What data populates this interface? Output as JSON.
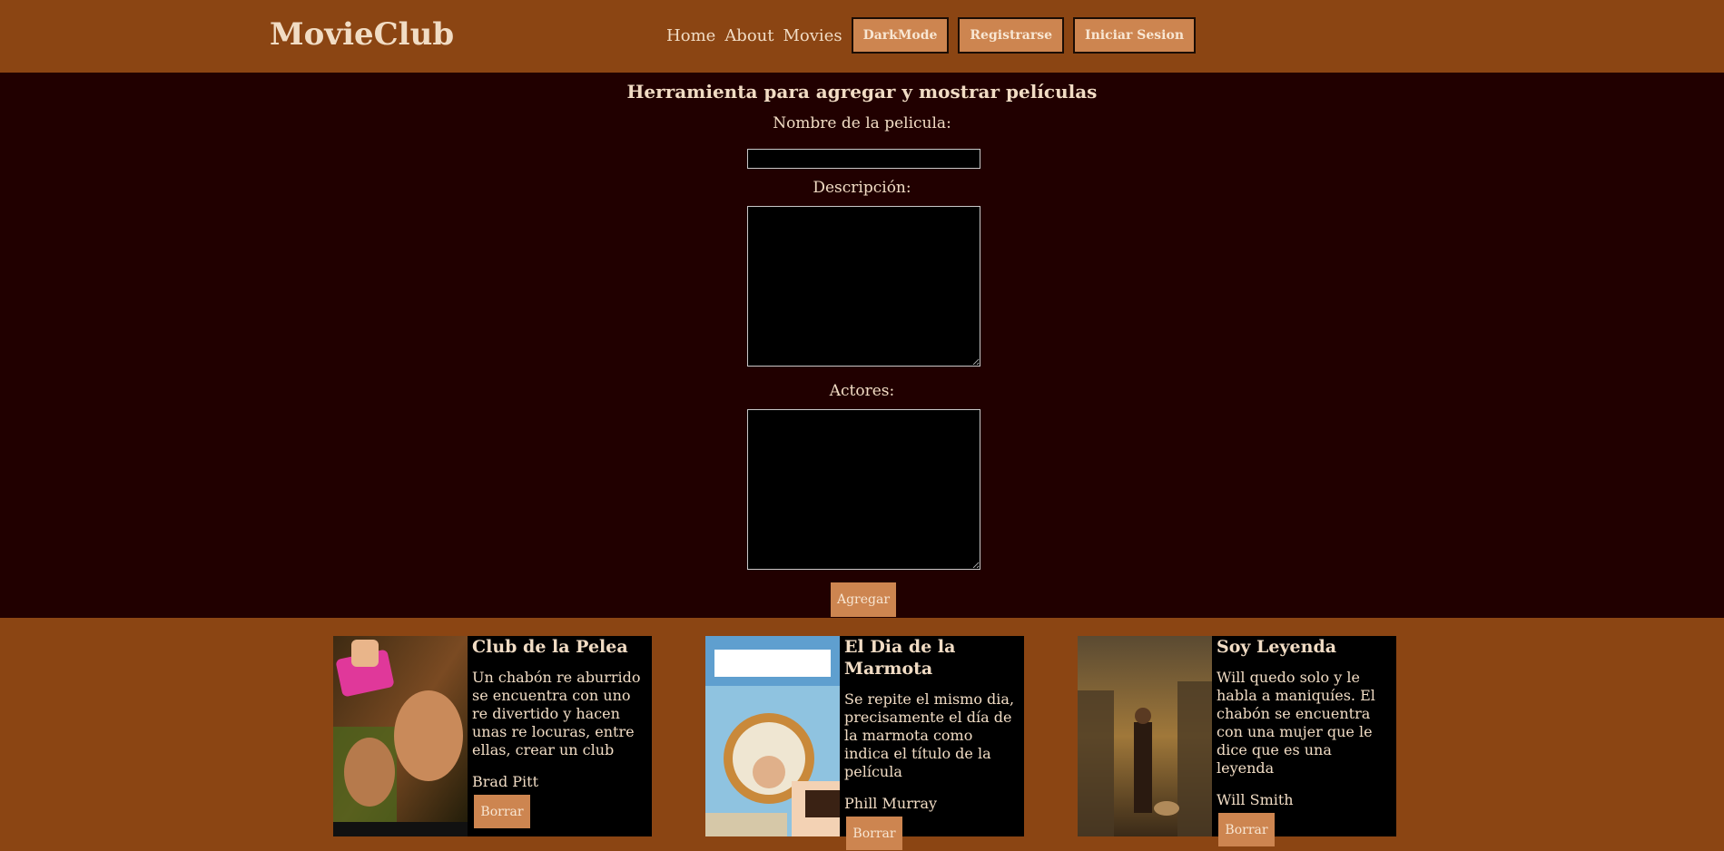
{
  "header": {
    "logo": "MovieClub",
    "nav_links": [
      "Home",
      "About",
      "Movies"
    ],
    "buttons": [
      "DarkMode",
      "Registrarse",
      "Iniciar Sesion"
    ]
  },
  "form": {
    "title": "Herramienta para agregar y mostrar películas",
    "name_label": "Nombre de la pelicula:",
    "name_value": "",
    "description_label": "Descripción:",
    "description_value": "",
    "actors_label": "Actores:",
    "actors_value": "",
    "submit_label": "Agregar"
  },
  "movies": [
    {
      "title": "Club de la Pelea",
      "description": "Un chabón re aburrido se encuentra con uno re divertido y hacen unas re locuras, entre ellas, crear un club",
      "actor": "Brad Pitt",
      "delete_label": "Borrar",
      "poster_icon": "fight-club-poster"
    },
    {
      "title": "El Dia de la Marmota",
      "description": "Se repite el mismo dia, precisamente el día de la marmota como indica el título de la película",
      "actor": "Phill Murray",
      "delete_label": "Borrar",
      "poster_icon": "groundhog-day-poster"
    },
    {
      "title": "Soy Leyenda",
      "description": "Will quedo solo y le habla a maniquíes. El chabón se encuentra con una mujer que le dice que es una leyenda",
      "actor": "Will Smith",
      "delete_label": "Borrar",
      "poster_icon": "i-am-legend-poster"
    }
  ],
  "colors": {
    "header_bg": "#8b4513",
    "main_bg": "#210000",
    "button_bg": "#cd8550",
    "text": "#f1dcc4"
  }
}
